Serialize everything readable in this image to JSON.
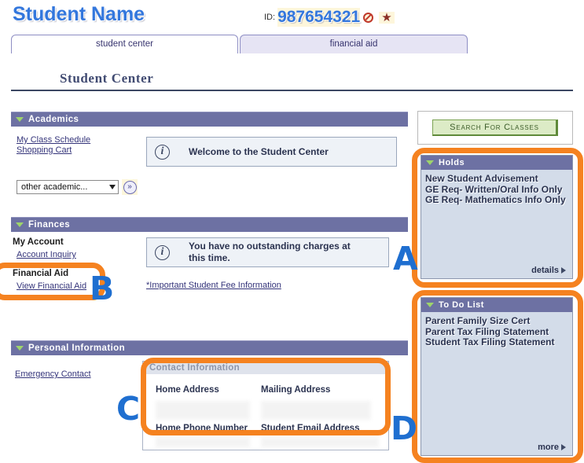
{
  "header": {
    "student_name": "Student Name",
    "id_label": "ID:",
    "id_value": "987654321",
    "icons": [
      "no-entry-icon",
      "star-icon"
    ]
  },
  "tabs": [
    {
      "label": "student center",
      "active": true
    },
    {
      "label": "financial aid",
      "active": false
    }
  ],
  "page_title": "Student Center",
  "sections": {
    "academics": {
      "title": "Academics",
      "links": [
        "My Class Schedule",
        "Shopping Cart"
      ],
      "dropdown": {
        "value": "other academic...",
        "go_label": "»"
      },
      "message": "Welcome to the Student Center"
    },
    "finances": {
      "title": "Finances",
      "group1_title": "My Account",
      "group1_links": [
        "Account Inquiry"
      ],
      "group2_title": "Financial Aid",
      "group2_links": [
        "View Financial Aid"
      ],
      "message": "You have no outstanding charges at this time.",
      "fee_link": "*Important Student Fee Information"
    },
    "personal_information": {
      "title": "Personal Information",
      "links": [
        "Emergency Contact"
      ],
      "contact_box_title": "Contact Information",
      "contact_fields": [
        "Home Address",
        "Mailing Address",
        "Home Phone Number",
        "Student Email Address"
      ]
    }
  },
  "right_column": {
    "search_button": "Search For Classes",
    "holds": {
      "title": "Holds",
      "items": [
        "New Student Advisement",
        "GE Req- Written/Oral Info Only",
        "GE Req- Mathematics Info Only"
      ],
      "more_label": "details"
    },
    "todo": {
      "title": "To Do List",
      "items": [
        "Parent Family Size Cert",
        "Parent Tax Filing Statement",
        "Student Tax Filing Statement"
      ],
      "more_label": "more"
    }
  },
  "annotations": {
    "highlight_color": "#f58220",
    "marker_color": "#1f6fd0",
    "markers": [
      {
        "letter": "A",
        "target": "holds-panel"
      },
      {
        "letter": "B",
        "target": "financial-aid-links"
      },
      {
        "letter": "C",
        "target": "contact-information-box"
      },
      {
        "letter": "D",
        "target": "to-do-list-panel"
      }
    ]
  }
}
